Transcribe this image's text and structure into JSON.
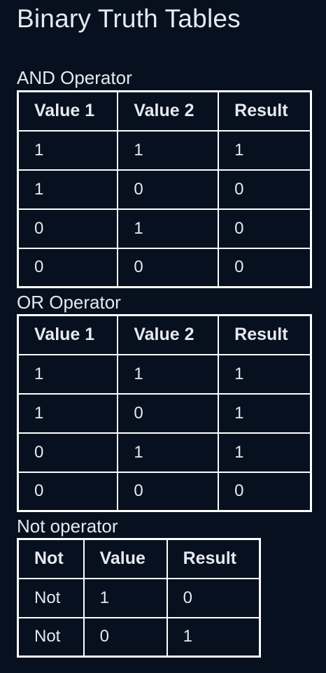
{
  "page": {
    "title": "Binary Truth Tables"
  },
  "and_table": {
    "caption": "AND Operator",
    "headers": [
      "Value 1",
      "Value 2",
      "Result"
    ],
    "rows": [
      [
        "1",
        "1",
        "1"
      ],
      [
        "1",
        "0",
        "0"
      ],
      [
        "0",
        "1",
        "0"
      ],
      [
        "0",
        "0",
        "0"
      ]
    ]
  },
  "or_table": {
    "caption": "OR Operator",
    "headers": [
      "Value 1",
      "Value 2",
      "Result"
    ],
    "rows": [
      [
        "1",
        "1",
        "1"
      ],
      [
        "1",
        "0",
        "1"
      ],
      [
        "0",
        "1",
        "1"
      ],
      [
        "0",
        "0",
        "0"
      ]
    ]
  },
  "not_table": {
    "caption": "Not operator",
    "headers": [
      "Not",
      "Value",
      "Result"
    ],
    "rows": [
      [
        "Not",
        "1",
        "0"
      ],
      [
        "Not",
        "0",
        "1"
      ]
    ]
  }
}
